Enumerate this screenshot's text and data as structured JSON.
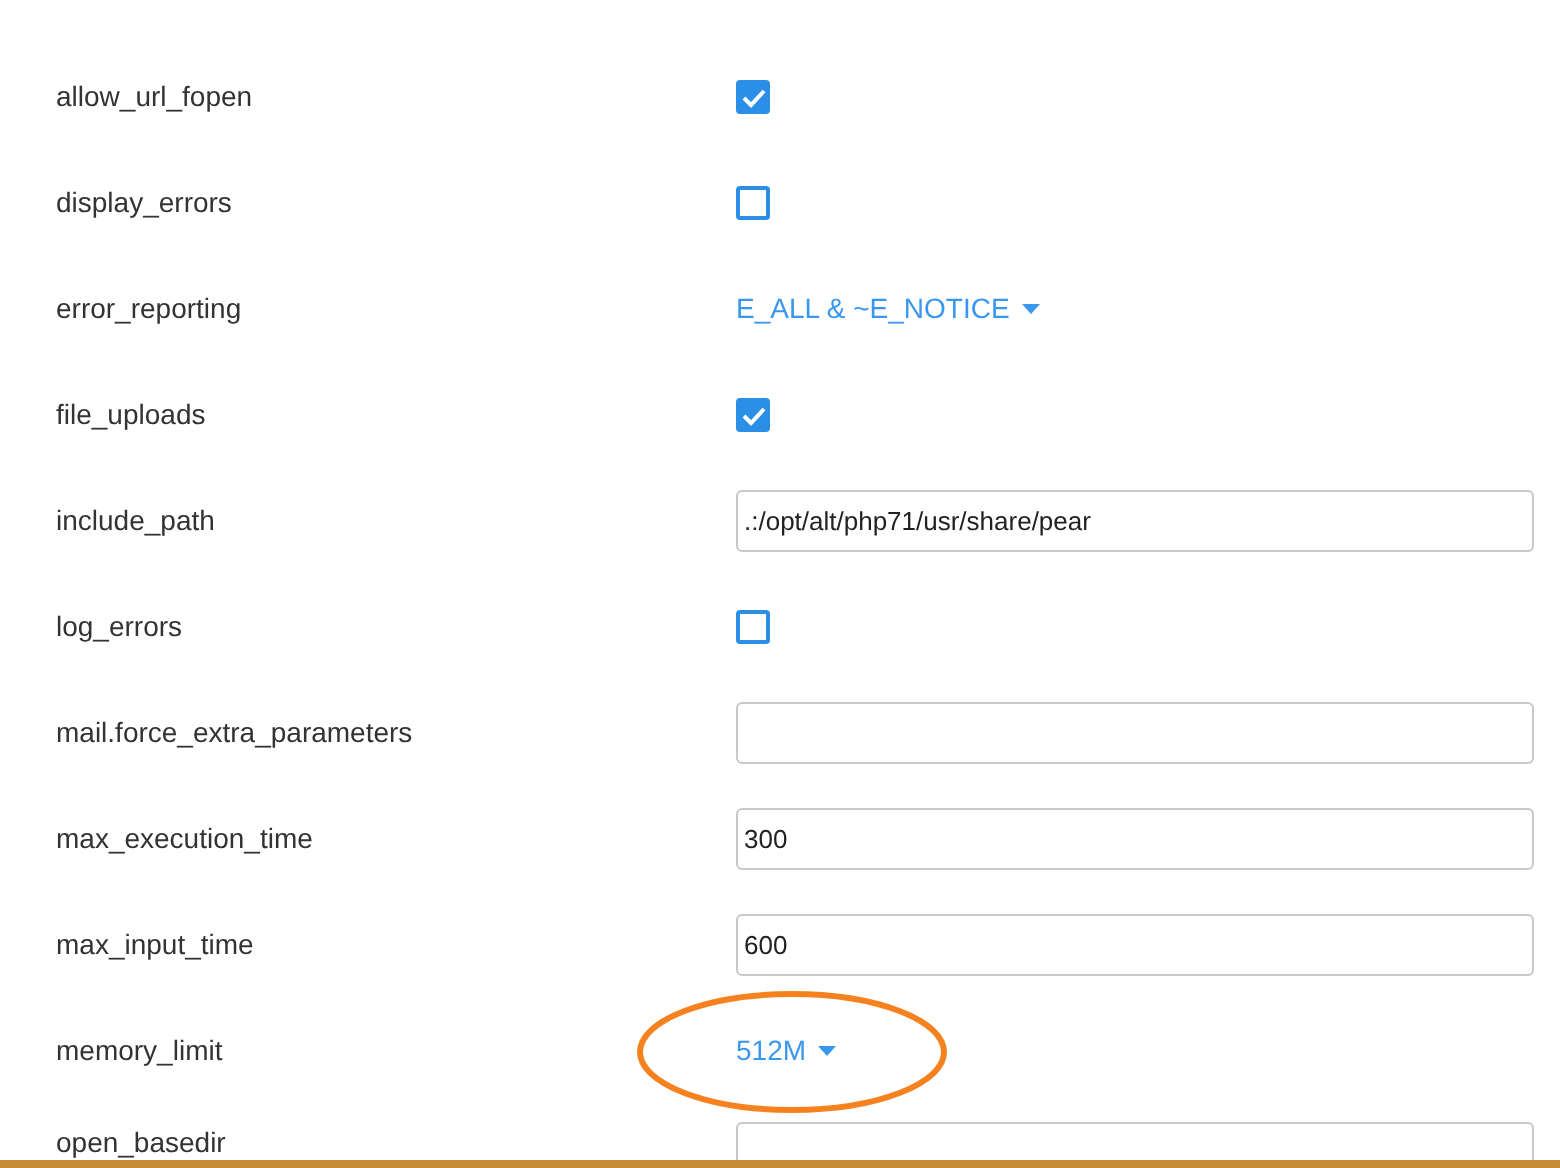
{
  "settings": [
    {
      "label": "allow_url_fopen",
      "kind": "checkbox",
      "checked": true
    },
    {
      "label": "display_errors",
      "kind": "checkbox",
      "checked": false
    },
    {
      "label": "error_reporting",
      "kind": "dropdown",
      "value": "E_ALL & ~E_NOTICE"
    },
    {
      "label": "file_uploads",
      "kind": "checkbox",
      "checked": true
    },
    {
      "label": "include_path",
      "kind": "input",
      "value": ".:/opt/alt/php71/usr/share/pear"
    },
    {
      "label": "log_errors",
      "kind": "checkbox",
      "checked": false
    },
    {
      "label": "mail.force_extra_parameters",
      "kind": "input"
    },
    {
      "label": "max_execution_time",
      "kind": "input",
      "value": "300"
    },
    {
      "label": "max_input_time",
      "kind": "input",
      "value": "600"
    },
    {
      "label": "memory_limit",
      "kind": "dropdown",
      "value": "512M",
      "circled": true
    },
    {
      "label": "open_basedir",
      "kind": "input"
    }
  ]
}
